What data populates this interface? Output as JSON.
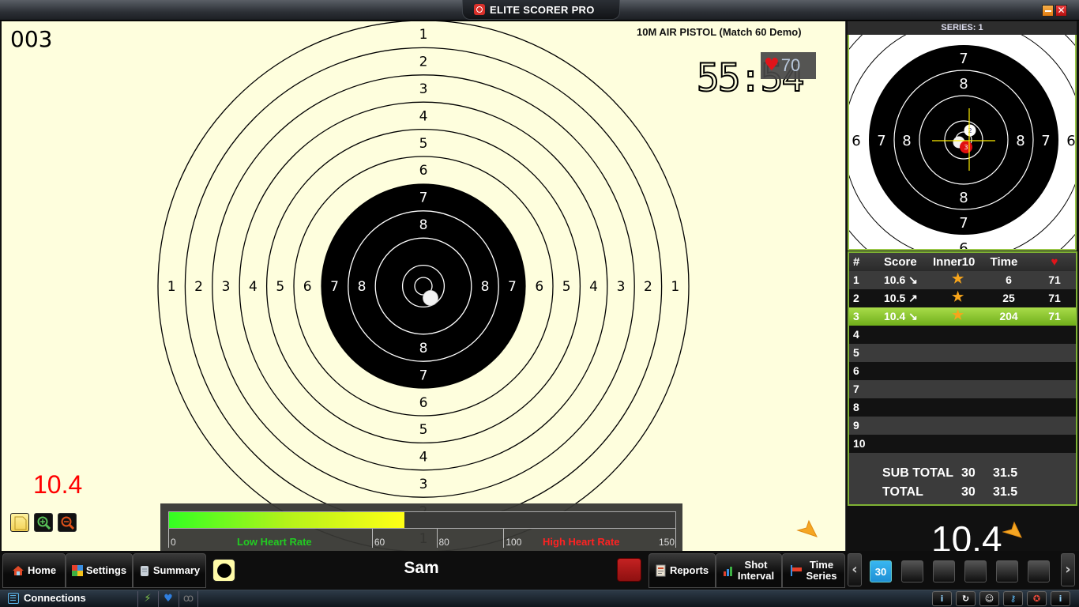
{
  "window": {
    "title": "ELITE SCORER PRO",
    "minimize_label": "",
    "close_label": "✕"
  },
  "target_view": {
    "shot_counter": "003",
    "match_title": "10M AIR PISTOL (Match 60 Demo)",
    "timer": "55:54",
    "heart_rate": "70",
    "last_score": "10.4",
    "ring_labels": [
      "1",
      "2",
      "3",
      "4",
      "5",
      "6",
      "7",
      "8"
    ],
    "tools": [
      "note-icon",
      "zoom-in-icon",
      "zoom-out-icon"
    ]
  },
  "heart_rate_bar": {
    "value": 70,
    "min": 0,
    "max": 150,
    "ticks": [
      {
        "label": "0",
        "value": 0
      },
      {
        "label": "60",
        "value": 60
      },
      {
        "label": "80",
        "value": 80
      },
      {
        "label": "100",
        "value": 100
      },
      {
        "label": "150",
        "value": 150
      }
    ],
    "low_label": "Low Heart Rate",
    "high_label": "High Heart Rate",
    "low_color": "#22cc22",
    "high_color": "#ff2222"
  },
  "series_panel": {
    "header": "SERIES: 1",
    "mini_target_labels": [
      "6",
      "7",
      "8"
    ],
    "shots_marked": [
      "2",
      "3"
    ]
  },
  "score_table": {
    "headers": {
      "num": "#",
      "score": "Score",
      "inner10": "Inner10",
      "time": "Time",
      "hr": "♥"
    },
    "rows": [
      {
        "num": "1",
        "score": "10.6",
        "dir": "↘",
        "inner10": "★",
        "time": "6",
        "hr": "71"
      },
      {
        "num": "2",
        "score": "10.5",
        "dir": "↗",
        "inner10": "★",
        "time": "25",
        "hr": "71"
      },
      {
        "num": "3",
        "score": "10.4",
        "dir": "↘",
        "inner10": "★",
        "time": "204",
        "hr": "71"
      },
      {
        "num": "4",
        "score": "",
        "dir": "",
        "inner10": "",
        "time": "",
        "hr": ""
      },
      {
        "num": "5",
        "score": "",
        "dir": "",
        "inner10": "",
        "time": "",
        "hr": ""
      },
      {
        "num": "6",
        "score": "",
        "dir": "",
        "inner10": "",
        "time": "",
        "hr": ""
      },
      {
        "num": "7",
        "score": "",
        "dir": "",
        "inner10": "",
        "time": "",
        "hr": ""
      },
      {
        "num": "8",
        "score": "",
        "dir": "",
        "inner10": "",
        "time": "",
        "hr": ""
      },
      {
        "num": "9",
        "score": "",
        "dir": "",
        "inner10": "",
        "time": "",
        "hr": ""
      },
      {
        "num": "10",
        "score": "",
        "dir": "",
        "inner10": "",
        "time": "",
        "hr": ""
      }
    ],
    "active_row": 3,
    "subtotal": {
      "label": "SUB TOTAL",
      "integer": "30",
      "decimal": "31.5"
    },
    "total": {
      "label": "TOTAL",
      "integer": "30",
      "decimal": "31.5"
    },
    "big_score": "10.4"
  },
  "bottom_bar": {
    "home": "Home",
    "settings": "Settings",
    "summary": "Summary",
    "shooter_name": "Sam",
    "reports": "Reports",
    "shot_interval": "Shot Interval",
    "time_series": "Time Series"
  },
  "series_nav": {
    "prev": "‹",
    "next": "›",
    "series": [
      "30",
      "",
      "",
      "",
      "",
      ""
    ],
    "active_index": 0
  },
  "status_bar": {
    "connections": "Connections",
    "system_buttons": [
      "info-icon",
      "refresh-icon",
      "user-icon",
      "key-icon",
      "help-icon",
      "about-icon"
    ]
  },
  "colors": {
    "target_background": "#fefedd",
    "accent_green": "#7fb234",
    "active_row": "#8cc63f",
    "series_active": "#2ba3e3",
    "last_score_red": "#ff0000"
  }
}
